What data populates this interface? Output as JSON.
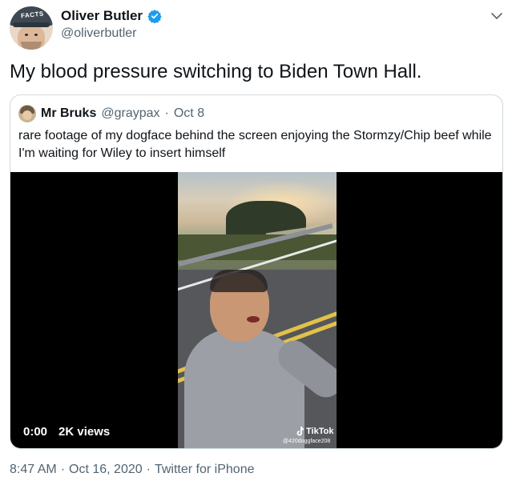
{
  "author": {
    "display_name": "Oliver Butler",
    "handle": "@oliverbutler",
    "avatar_cap_text": "FACTS",
    "verified": true
  },
  "tweet": {
    "text": "My blood pressure switching to Biden Town Hall."
  },
  "quoted_tweet": {
    "display_name": "Mr Bruks",
    "handle": "@graypax",
    "separator": "·",
    "date": "Oct 8",
    "text": "rare footage of my dogface behind the screen enjoying the Stormzy/Chip beef while I'm waiting for Wiley to insert himself",
    "video": {
      "time": "0:00",
      "views": "2K views",
      "watermark_brand": "TikTok",
      "watermark_handle": "@420doggface208"
    }
  },
  "footer": {
    "time": "8:47 AM",
    "sep1": "·",
    "date": "Oct 16, 2020",
    "sep2": "·",
    "source": "Twitter for iPhone"
  },
  "colors": {
    "verified_blue": "#1d9bf0",
    "secondary_text": "#536471",
    "border": "#cfd9de"
  },
  "icons": [
    "verified-badge-icon",
    "chevron-down-icon",
    "tiktok-logo-icon"
  ]
}
